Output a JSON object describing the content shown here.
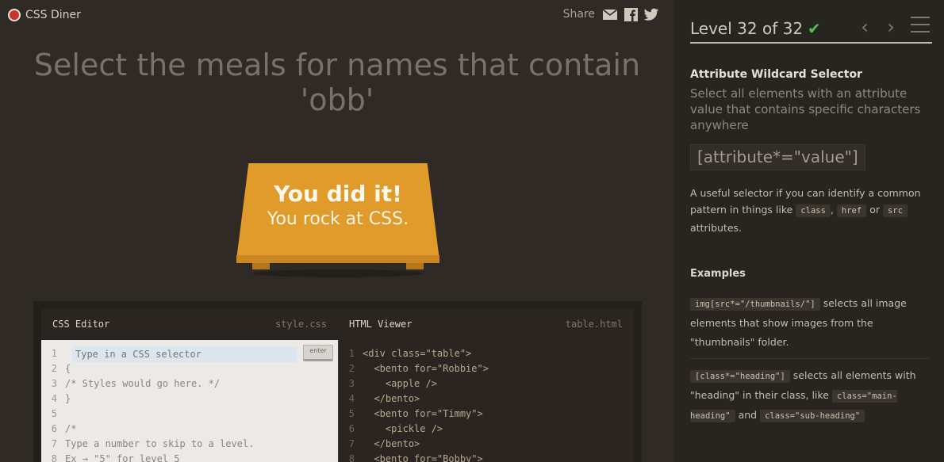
{
  "header": {
    "app_name": "CSS Diner",
    "share_label": "Share"
  },
  "order": {
    "text": "Select the meals for names that contain 'obb'"
  },
  "table": {
    "win_title": "You did it!",
    "win_subtitle": "You rock at CSS."
  },
  "editor": {
    "css_title": "CSS Editor",
    "css_file": "style.css",
    "html_title": "HTML Viewer",
    "html_file": "table.html",
    "input_placeholder": "Type in a CSS selector",
    "enter_label": "enter",
    "css_lines": [
      {
        "n": "1",
        "text": ""
      },
      {
        "n": "2",
        "text": "{"
      },
      {
        "n": "3",
        "text": "/* Styles would go here. */"
      },
      {
        "n": "4",
        "text": "}"
      },
      {
        "n": "5",
        "text": ""
      },
      {
        "n": "6",
        "text": "/*"
      },
      {
        "n": "7",
        "text": "Type a number to skip to a level."
      },
      {
        "n": "8",
        "text": "Ex → \"5\" for level 5"
      }
    ],
    "html_lines": [
      {
        "n": "1",
        "text": "<div class=\"table\">"
      },
      {
        "n": "2",
        "text": "  <bento for=\"Robbie\">"
      },
      {
        "n": "3",
        "text": "    <apple />"
      },
      {
        "n": "4",
        "text": "  </bento>"
      },
      {
        "n": "5",
        "text": "  <bento for=\"Timmy\">"
      },
      {
        "n": "6",
        "text": "    <pickle />"
      },
      {
        "n": "7",
        "text": "  </bento>"
      },
      {
        "n": "8",
        "text": "  <bento for=\"Bobby\">"
      }
    ]
  },
  "sidebar": {
    "level_text": "Level 32 of 32",
    "progress": 1.0,
    "selector_name": "Attribute Wildcard Selector",
    "title": "Select all elements with an attribute value that contains specific characters anywhere",
    "syntax": "[attribute*=\"value\"]",
    "hint_parts": [
      "A useful selector if you can identify a common pattern in things like ",
      "class",
      ",",
      "href",
      "or",
      "src",
      "attributes."
    ],
    "examples_heading": "Examples",
    "example1_code": "img[src*=\"/thumbnails/\"]",
    "example1_text": "selects all image elements that show images from the \"thumbnails\" folder.",
    "example2_code": "[class*=\"heading\"]",
    "example2_text": "selects all elements with \"heading\" in their class, like",
    "example2_code2": "class=\"main-heading\"",
    "example2_and": "and",
    "example2_code3": "class=\"sub-heading\""
  },
  "colors": {
    "accent": "#e19b2b",
    "success": "#4cc24f",
    "background": "#2f2a25",
    "sidebar": "#28241f"
  }
}
